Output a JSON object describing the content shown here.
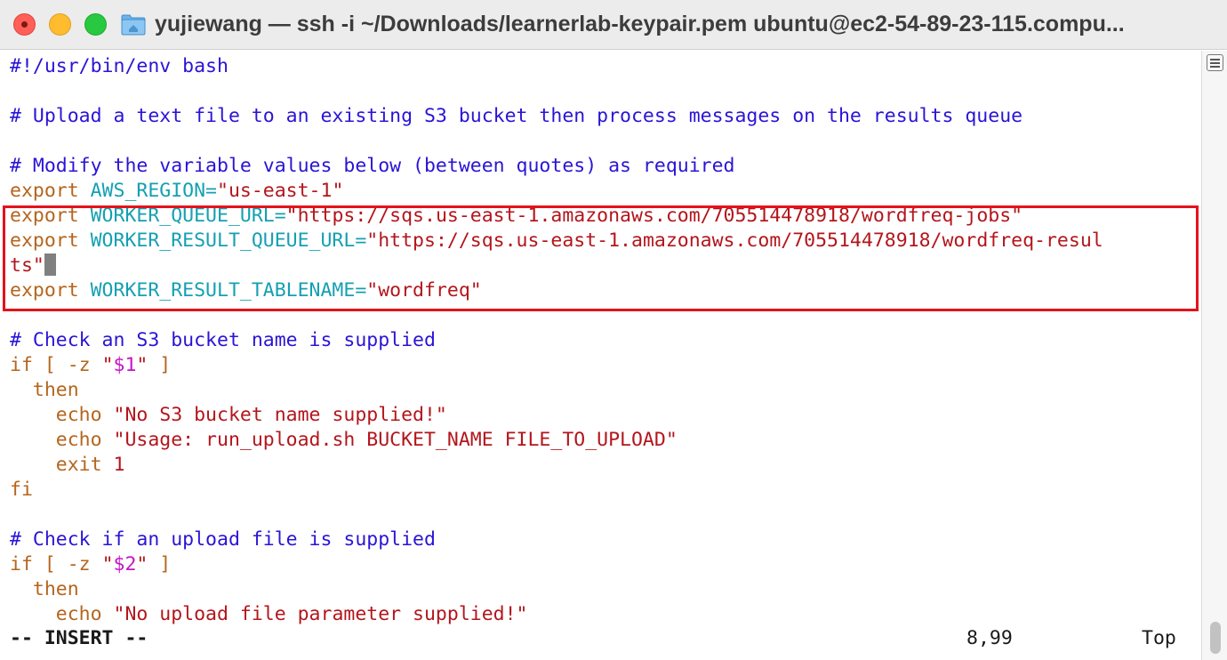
{
  "window": {
    "title": "yujiewang — ssh -i ~/Downloads/learnerlab-keypair.pem ubuntu@ec2-54-89-23-115.compu..."
  },
  "colors": {
    "comment": "#2a14d6",
    "keyword": "#b5651d",
    "variable": "#15a0b2",
    "string": "#b3161c",
    "special": "#c415c4",
    "highlight_box": "#e5121b"
  },
  "editor": {
    "lines": [
      {
        "row": 0,
        "segments": [
          {
            "t": "#!/usr/bin/env bash",
            "c": "comment"
          }
        ]
      },
      {
        "row": 2,
        "segments": [
          {
            "t": "# Upload a text file to an existing S3 bucket then process messages on the results queue",
            "c": "comment"
          }
        ]
      },
      {
        "row": 4,
        "segments": [
          {
            "t": "# Modify the variable values below (between quotes) as required",
            "c": "comment"
          }
        ]
      },
      {
        "row": 5,
        "segments": [
          {
            "t": "export ",
            "c": "kw"
          },
          {
            "t": "AWS_REGION=",
            "c": "var"
          },
          {
            "t": "\"us-east-1\"",
            "c": "str"
          }
        ]
      },
      {
        "row": 6,
        "segments": [
          {
            "t": "export ",
            "c": "kw"
          },
          {
            "t": "WORKER_QUEUE_URL=",
            "c": "var"
          },
          {
            "t": "\"https://sqs.us-east-1.amazonaws.com/705514478918/wordfreq-jobs\"",
            "c": "str"
          }
        ]
      },
      {
        "row": 7,
        "segments": [
          {
            "t": "export ",
            "c": "kw"
          },
          {
            "t": "WORKER_RESULT_QUEUE_URL=",
            "c": "var"
          },
          {
            "t": "\"https://sqs.us-east-1.amazonaws.com/705514478918/wordfreq-resul",
            "c": "str"
          }
        ]
      },
      {
        "row": 8,
        "cursor": true,
        "segments": [
          {
            "t": "ts\"",
            "c": "str"
          }
        ]
      },
      {
        "row": 9,
        "segments": [
          {
            "t": "export ",
            "c": "kw"
          },
          {
            "t": "WORKER_RESULT_TABLENAME=",
            "c": "var"
          },
          {
            "t": "\"wordfreq\"",
            "c": "str"
          }
        ]
      },
      {
        "row": 11,
        "segments": [
          {
            "t": "# Check an S3 bucket name is supplied",
            "c": "comment"
          }
        ]
      },
      {
        "row": 12,
        "segments": [
          {
            "t": "if [ -z ",
            "c": "kw"
          },
          {
            "t": "\"",
            "c": "str"
          },
          {
            "t": "$1",
            "c": "special"
          },
          {
            "t": "\"",
            "c": "str"
          },
          {
            "t": " ]",
            "c": "kw"
          }
        ]
      },
      {
        "row": 13,
        "segments": [
          {
            "t": "  then",
            "c": "kw"
          }
        ]
      },
      {
        "row": 14,
        "segments": [
          {
            "t": "    echo ",
            "c": "kw"
          },
          {
            "t": "\"No S3 bucket name supplied!\"",
            "c": "str"
          }
        ]
      },
      {
        "row": 15,
        "segments": [
          {
            "t": "    echo ",
            "c": "kw"
          },
          {
            "t": "\"Usage: run_upload.sh BUCKET_NAME FILE_TO_UPLOAD\"",
            "c": "str"
          }
        ]
      },
      {
        "row": 16,
        "segments": [
          {
            "t": "    exit ",
            "c": "kw"
          },
          {
            "t": "1",
            "c": "str"
          }
        ]
      },
      {
        "row": 17,
        "segments": [
          {
            "t": "fi",
            "c": "kw"
          }
        ]
      },
      {
        "row": 19,
        "segments": [
          {
            "t": "# Check if an upload file is supplied",
            "c": "comment"
          }
        ]
      },
      {
        "row": 20,
        "segments": [
          {
            "t": "if [ -z ",
            "c": "kw"
          },
          {
            "t": "\"",
            "c": "str"
          },
          {
            "t": "$2",
            "c": "special"
          },
          {
            "t": "\"",
            "c": "str"
          },
          {
            "t": " ]",
            "c": "kw"
          }
        ]
      },
      {
        "row": 21,
        "segments": [
          {
            "t": "  then",
            "c": "kw"
          }
        ]
      },
      {
        "row": 22,
        "segments": [
          {
            "t": "    echo ",
            "c": "kw"
          },
          {
            "t": "\"No upload file parameter supplied!\"",
            "c": "str"
          }
        ]
      }
    ]
  },
  "status": {
    "mode": "-- INSERT --",
    "position": "8,99",
    "scroll": "Top"
  }
}
